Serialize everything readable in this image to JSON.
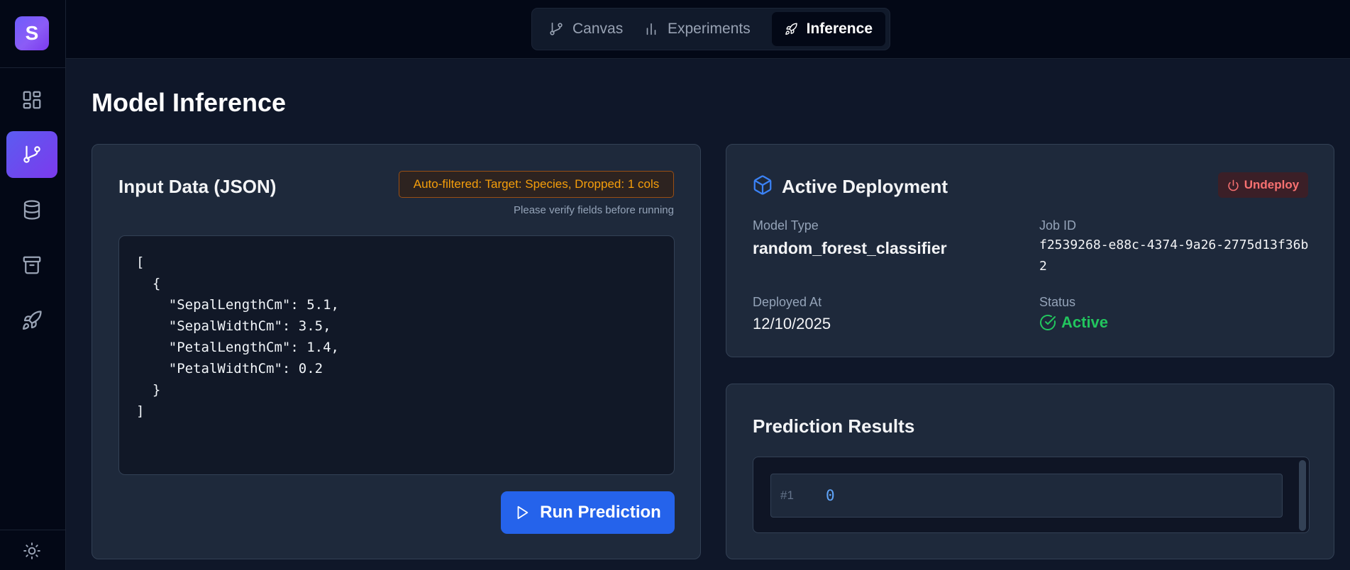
{
  "sidebar": {
    "logo_letter": "S",
    "items": [
      {
        "icon": "grid-icon"
      },
      {
        "icon": "branch-icon"
      },
      {
        "icon": "database-icon"
      },
      {
        "icon": "archive-icon"
      },
      {
        "icon": "rocket-icon"
      }
    ],
    "footer_icon": "sun-icon"
  },
  "topbar": {
    "tabs": [
      {
        "label": "Canvas",
        "icon": "branch-icon"
      },
      {
        "label": "Experiments",
        "icon": "bar-chart-icon"
      },
      {
        "label": "Inference",
        "icon": "rocket-icon",
        "active": true
      }
    ]
  },
  "page": {
    "title": "Model Inference"
  },
  "input_card": {
    "title": "Input Data (JSON)",
    "filter_badge": "Auto-filtered: Target: Species, Dropped: 1 cols",
    "hint": "Please verify fields before running",
    "code_lines": [
      "[",
      "  {",
      "    \"SepalLengthCm\": 5.1,",
      "    \"SepalWidthCm\": 3.5,",
      "    \"PetalLengthCm\": 1.4,",
      "    \"PetalWidthCm\": 0.2",
      "  }",
      "]"
    ],
    "run_label": "Run Prediction"
  },
  "deployment_card": {
    "title": "Active Deployment",
    "undeploy_label": "Undeploy",
    "model_type_label": "Model Type",
    "model_type_value": "random_forest_classifier",
    "job_id_label": "Job ID",
    "job_id_value": "f2539268-e88c-4374-9a26-2775d13f36b2",
    "deployed_at_label": "Deployed At",
    "deployed_at_value": "12/10/2025",
    "status_label": "Status",
    "status_value": "Active"
  },
  "results_card": {
    "title": "Prediction Results",
    "results": [
      {
        "index": "#1",
        "value": "0"
      }
    ]
  },
  "colors": {
    "accent": "#2563eb",
    "active_status": "#22c55e",
    "warning": "#f59e0b",
    "danger": "#f87171"
  }
}
